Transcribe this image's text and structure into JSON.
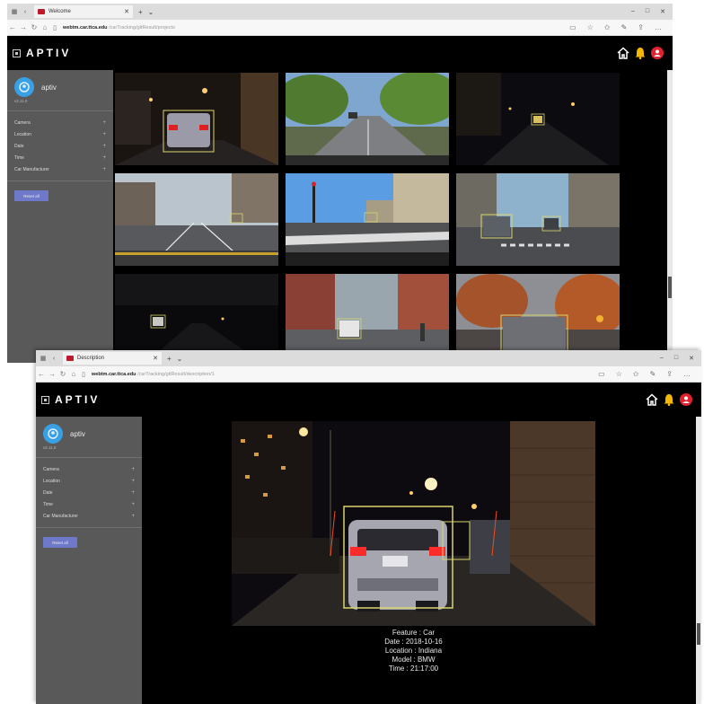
{
  "screen1": {
    "tab_title": "Welcome",
    "url_host": "webtm.car.ttca.edu",
    "url_path": "/carTracking/gitResult/projects",
    "brand": "APTIV",
    "user": {
      "name": "aptiv",
      "version": "v2.11.0"
    },
    "filters": [
      "Camera",
      "Location",
      "Date",
      "Time",
      "Car Manufacturer"
    ],
    "reset_label": "Reset all"
  },
  "screen2": {
    "tab_title": "Description",
    "url_host": "webtm.car.ttca.edu",
    "url_path": "/carTracking/gitResult/description/1",
    "brand": "APTIV",
    "user": {
      "name": "aptiv",
      "version": "v2.11.0"
    },
    "filters": [
      "Camera",
      "Location",
      "Date",
      "Time",
      "Car Manufacturer"
    ],
    "reset_label": "Reset all",
    "detail": {
      "feature": "Feature : Car",
      "date": "Date : 2018-10-16",
      "location": "Location : Indiana",
      "model": "Model : BMW",
      "time": "Time : 21:17:00"
    }
  },
  "icons": [
    "home-icon",
    "bell-icon",
    "user-icon",
    "back-icon",
    "forward-icon",
    "refresh-icon",
    "lock-icon",
    "star-icon"
  ],
  "colors": {
    "accent": "#6e79c9",
    "sidebar": "#595959",
    "bbox": "#d8d570",
    "notification": "#f5b800",
    "user": "#e0232e"
  }
}
